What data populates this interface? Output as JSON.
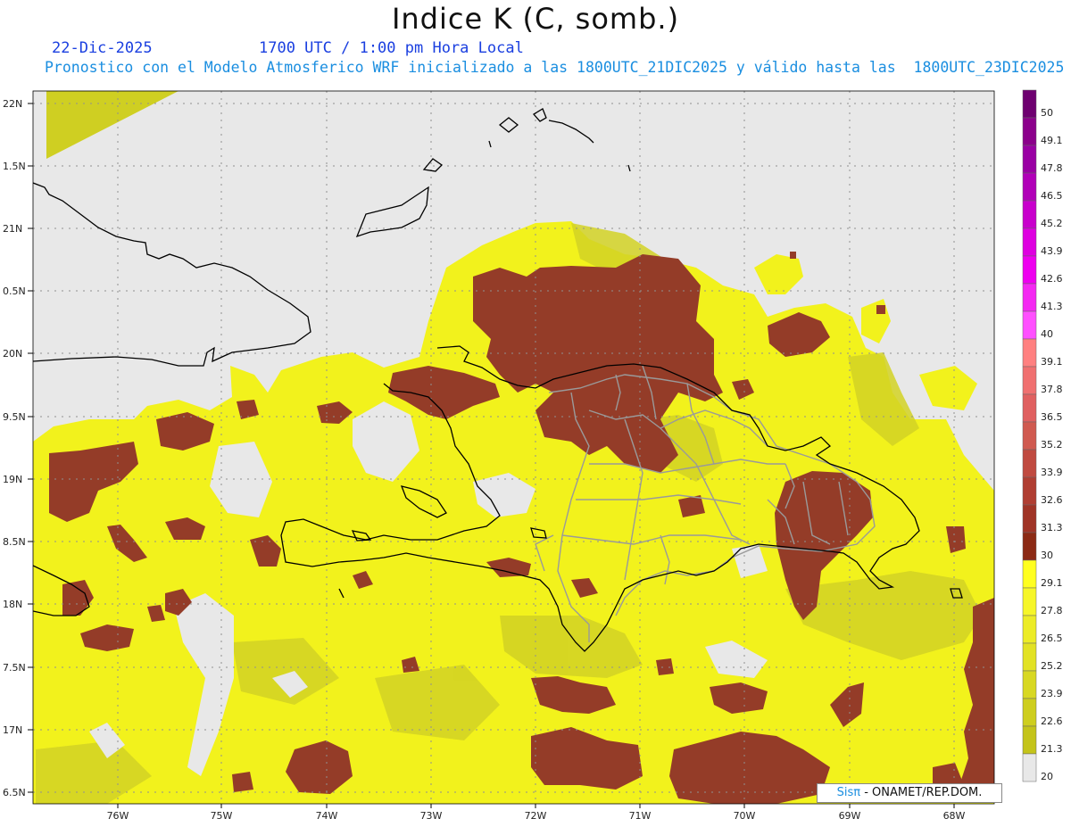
{
  "header": {
    "title": "Indice K (C, somb.)",
    "date": "22-Dic-2025",
    "time": "1700 UTC / 1:00 pm Hora Local",
    "description": "Pronostico con el Modelo Atmosferico WRF inicializado a las 1800UTC_21DIC2025 y válido hasta las  1800UTC_23DIC2025"
  },
  "credit": {
    "brand": "Sisπ",
    "org": " - ONAMET/REP.DOM."
  },
  "axes": {
    "lat_labels": [
      "22N",
      "1.5N",
      "21N",
      "0.5N",
      "20N",
      "9.5N",
      "19N",
      "8.5N",
      "18N",
      "7.5N",
      "17N",
      "6.5N"
    ],
    "lon_labels": [
      "76W",
      "75W",
      "74W",
      "73W",
      "72W",
      "71W",
      "70W",
      "69W",
      "68W"
    ]
  },
  "colorbar": {
    "labels": [
      "50",
      "49.1",
      "47.8",
      "46.5",
      "45.2",
      "43.9",
      "42.6",
      "41.3",
      "40",
      "39.1",
      "37.8",
      "36.5",
      "35.2",
      "33.9",
      "32.6",
      "31.3",
      "30",
      "29.1",
      "27.8",
      "26.5",
      "25.2",
      "23.9",
      "22.6",
      "21.3",
      "20"
    ],
    "colors": [
      "#6e0070",
      "#8b008b",
      "#9a00a4",
      "#b100b8",
      "#c800cc",
      "#de00e0",
      "#ee00ef",
      "#f428f2",
      "#ff50ff",
      "#ff8080",
      "#f07070",
      "#e06060",
      "#d05a50",
      "#c04a40",
      "#b03e32",
      "#a03426",
      "#8c2a14",
      "#ffff20",
      "#f6f628",
      "#ecec26",
      "#e2e224",
      "#d8d822",
      "#cece1e",
      "#c4c41a",
      "#e8e8e8"
    ]
  },
  "colors": {
    "background": "#e8e8e8",
    "yellow_bright": "#f4f41e",
    "yellow_olive": "#cfcf22",
    "brown": "#943c28",
    "coast": "#000000",
    "borders": "#999999"
  }
}
